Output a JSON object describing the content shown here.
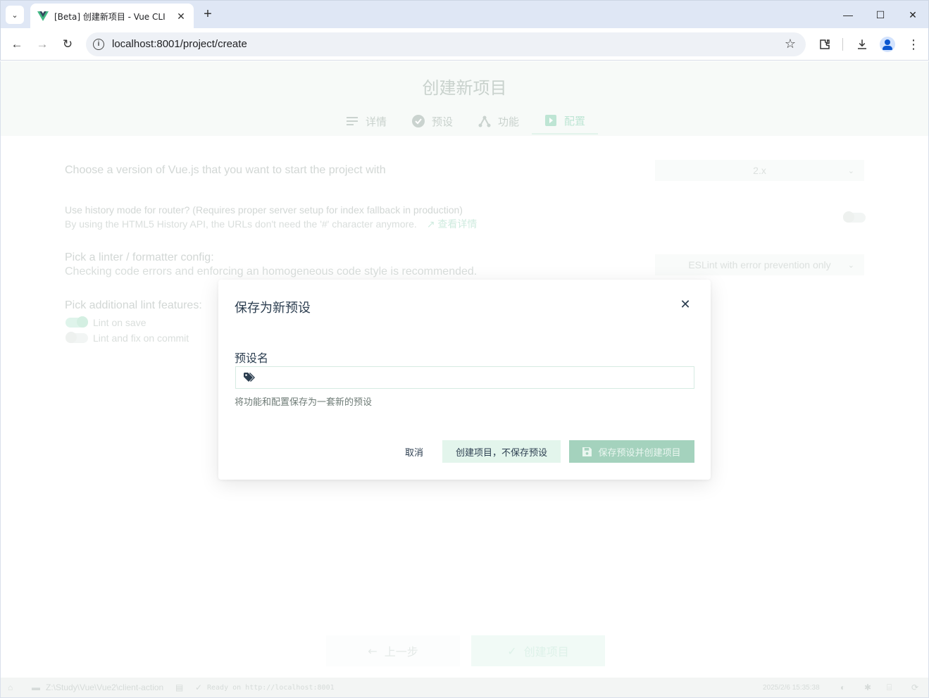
{
  "browser": {
    "tab_title": "[Beta] 创建新项目 - Vue CLI",
    "url": "localhost:8001/project/create",
    "window_controls": {
      "minimize": "—",
      "maximize": "☐",
      "close": "✕"
    }
  },
  "page": {
    "title": "创建新项目",
    "steps": [
      {
        "label": "详情",
        "icon": "list-icon"
      },
      {
        "label": "预设",
        "icon": "check-circle-icon"
      },
      {
        "label": "功能",
        "icon": "features-icon"
      },
      {
        "label": "配置",
        "icon": "config-icon",
        "active": true
      }
    ],
    "options": {
      "vue_version": {
        "label": "Choose a version of Vue.js that you want to start the project with",
        "value": "2.x"
      },
      "history_mode": {
        "label": "Use history mode for router? (Requires proper server setup for index fallback in production)",
        "description": "By using the HTML5 History API, the URLs don't need the '#' character anymore.",
        "link": "查看详情"
      },
      "linter": {
        "label": "Pick a linter / formatter config:",
        "description": "Checking code errors and enforcing an homogeneous code style is recommended.",
        "value": "ESLint with error prevention only"
      },
      "lint_features": {
        "label": "Pick additional lint features:",
        "items": [
          {
            "label": "Lint on save",
            "on": true
          },
          {
            "label": "Lint and fix on commit",
            "on": false
          }
        ]
      }
    },
    "buttons": {
      "prev": "上一步",
      "create": "创建项目"
    }
  },
  "statusbar": {
    "path": "Z:\\Study\\Vue\\Vue2\\client-action",
    "log": "Ready on http://localhost:8001",
    "datetime": "2025/2/6 15:35:38"
  },
  "modal": {
    "title": "保存为新预设",
    "field_label": "预设名",
    "field_value": "",
    "field_description": "将功能和配置保存为一套新的预设",
    "cancel": "取消",
    "create_no_save": "创建项目，不保存预设",
    "save_and_create": "保存预设并创建项目"
  },
  "colors": {
    "accent": "#42b983",
    "save_button": "#a4d2bd",
    "no_save_button": "#e3f5ec",
    "text": "#2c3e50"
  }
}
